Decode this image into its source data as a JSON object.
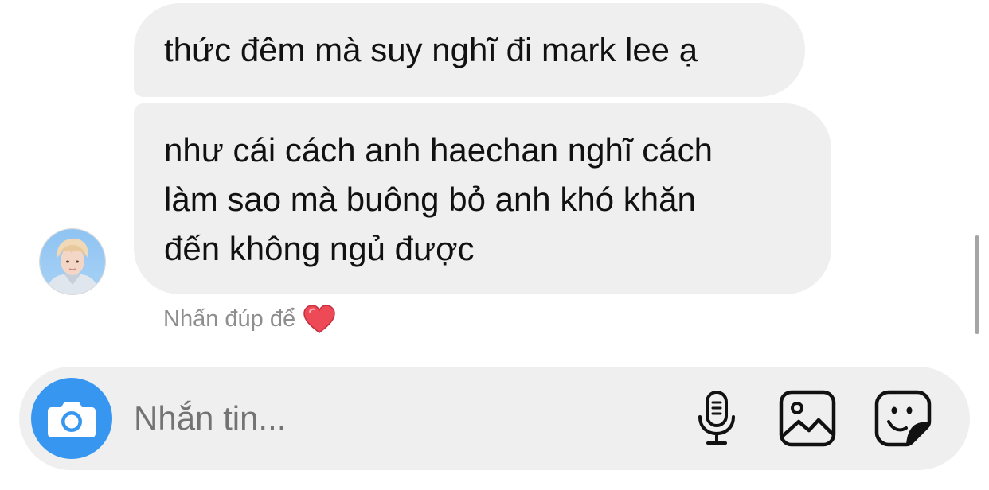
{
  "messages": [
    {
      "text": "thức đêm mà suy nghĩ đi mark lee ạ"
    },
    {
      "text": "như cái cách anh haechan nghĩ cách\nlàm sao mà buông bỏ anh khó khăn\nđến không ngủ được"
    }
  ],
  "hint": {
    "text": "Nhấn đúp để",
    "icon": "heart-icon",
    "icon_color": "#ed4956"
  },
  "composer": {
    "placeholder": "Nhắn tin...",
    "value": "",
    "camera_icon": "camera-icon",
    "mic_icon": "microphone-icon",
    "gallery_icon": "image-icon",
    "sticker_icon": "sticker-icon"
  },
  "colors": {
    "accent": "#3797f0",
    "bubble": "#efefef",
    "hint_text": "#8e8e8e"
  }
}
